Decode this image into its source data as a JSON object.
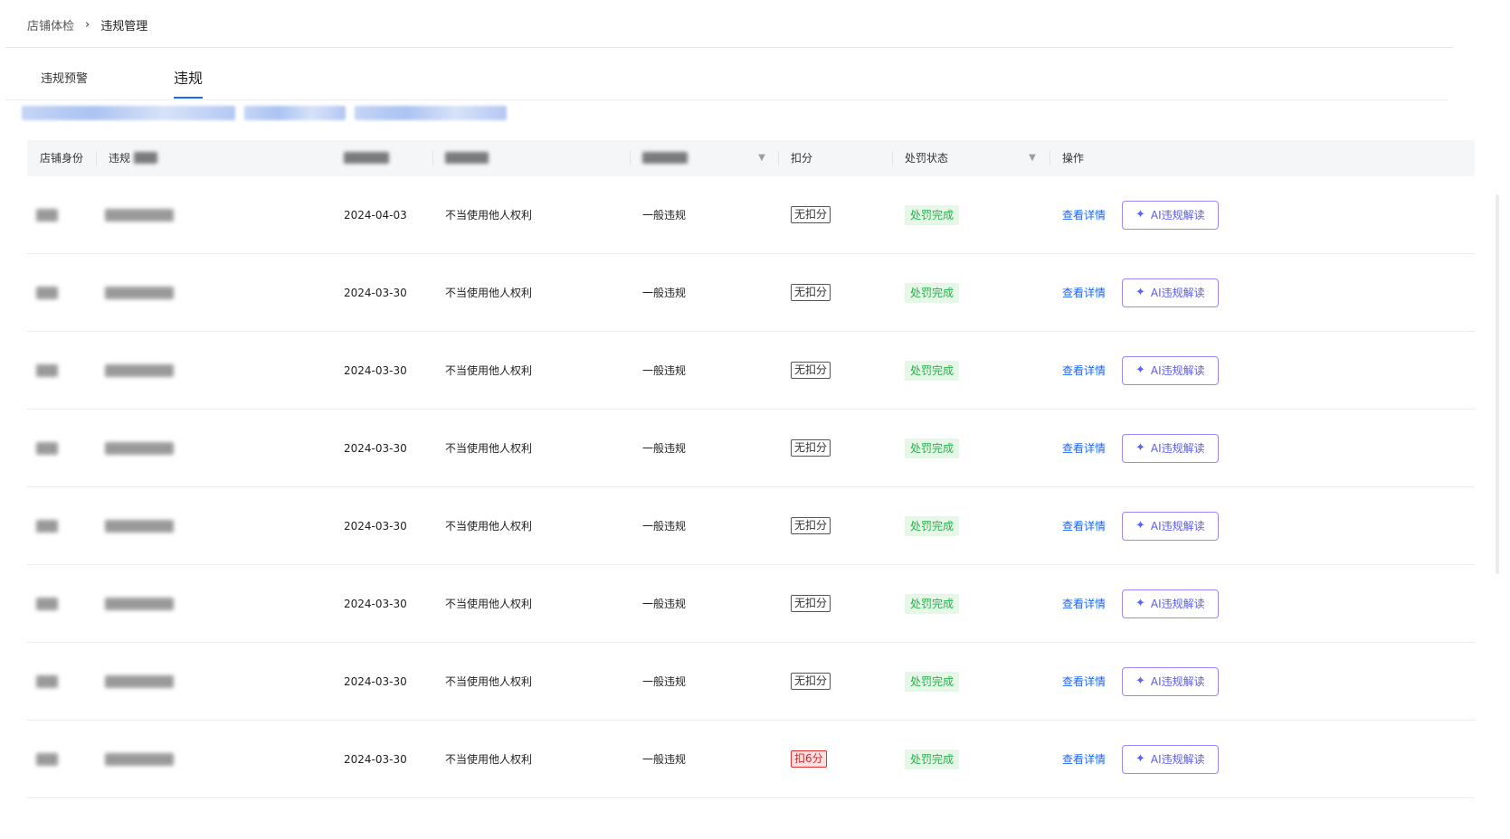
{
  "breadcrumb": {
    "items": [
      "店铺体检",
      "违规管理"
    ],
    "separator": "›"
  },
  "tabs": {
    "warning": "违规预警",
    "violation": "违规"
  },
  "table": {
    "headers": {
      "shop_identity": "店铺身份",
      "violation_prefix": "违规",
      "score": "扣分",
      "status": "处罚状态",
      "action": "操作"
    },
    "rows": [
      {
        "date": "2024-04-03",
        "type": "不当使用他人权利",
        "severity": "一般违规",
        "score": "无扣分",
        "status": "处罚完成",
        "detail": "查看详情",
        "ai": "AI违规解读"
      },
      {
        "date": "2024-03-30",
        "type": "不当使用他人权利",
        "severity": "一般违规",
        "score": "无扣分",
        "status": "处罚完成",
        "detail": "查看详情",
        "ai": "AI违规解读"
      },
      {
        "date": "2024-03-30",
        "type": "不当使用他人权利",
        "severity": "一般违规",
        "score": "无扣分",
        "status": "处罚完成",
        "detail": "查看详情",
        "ai": "AI违规解读"
      },
      {
        "date": "2024-03-30",
        "type": "不当使用他人权利",
        "severity": "一般违规",
        "score": "无扣分",
        "status": "处罚完成",
        "detail": "查看详情",
        "ai": "AI违规解读"
      },
      {
        "date": "2024-03-30",
        "type": "不当使用他人权利",
        "severity": "一般违规",
        "score": "无扣分",
        "status": "处罚完成",
        "detail": "查看详情",
        "ai": "AI违规解读"
      },
      {
        "date": "2024-03-30",
        "type": "不当使用他人权利",
        "severity": "一般违规",
        "score": "无扣分",
        "status": "处罚完成",
        "detail": "查看详情",
        "ai": "AI违规解读"
      },
      {
        "date": "2024-03-30",
        "type": "不当使用他人权利",
        "severity": "一般违规",
        "score": "无扣分",
        "status": "处罚完成",
        "detail": "查看详情",
        "ai": "AI违规解读"
      },
      {
        "date": "2024-03-30",
        "type": "不当使用他人权利",
        "severity": "一般违规",
        "score": "扣6分",
        "score_style": "red",
        "status": "处罚完成",
        "detail": "查看详情",
        "ai": "AI违规解读"
      }
    ]
  },
  "colors": {
    "accent": "#1966ff",
    "ai_border": "#9a86ff",
    "status_green": "#23b24a",
    "deduct_red": "#e0302f"
  },
  "icons": {
    "ai": "sparkle-icon",
    "filter": "filter-icon"
  }
}
